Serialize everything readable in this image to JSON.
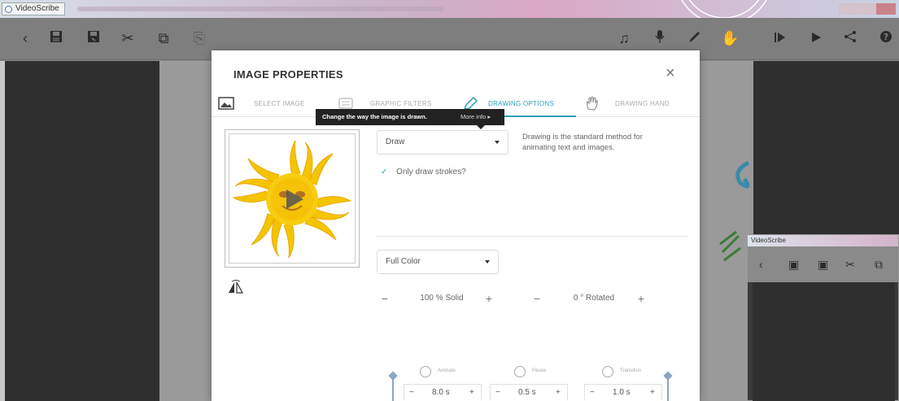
{
  "window": {
    "app_tab_label": "VideoScribe"
  },
  "toolbar": {
    "left_icons": [
      "back-icon",
      "save-icon",
      "save-as-icon",
      "cut-icon",
      "copy-icon",
      "paste-icon"
    ],
    "right_icons": [
      "music-icon",
      "microphone-icon",
      "pen-icon",
      "hand-icon",
      "play-from-icon",
      "play-icon",
      "share-icon",
      "help-icon"
    ]
  },
  "modal": {
    "title": "IMAGE PROPERTIES",
    "close_symbol": "×",
    "tabs": [
      {
        "label": "SELECT IMAGE",
        "icon": "image-icon",
        "active": false
      },
      {
        "label": "GRAPHIC FILTERS",
        "icon": "filters-icon",
        "active": false
      },
      {
        "label": "DRAWING OPTIONS",
        "icon": "pencil-icon",
        "active": true
      },
      {
        "label": "DRAWING HAND",
        "icon": "hand-icon",
        "active": false
      }
    ],
    "tooltip": {
      "text": "Change the way the image is drawn.",
      "more": "More info ▸"
    },
    "draw_mode": {
      "selected": "Draw",
      "description": "Drawing is the standard method for animating text and images."
    },
    "only_strokes": {
      "checked": true,
      "label": "Only draw strokes?"
    },
    "color_mode": {
      "selected": "Full Color"
    },
    "opacity": {
      "minus": "−",
      "value": "100 % Solid",
      "plus": "+"
    },
    "rotation": {
      "minus": "−",
      "value": "0 ° Rotated",
      "plus": "+"
    },
    "timings": [
      {
        "label": "Animate",
        "value": "8.0 s",
        "minus": "−",
        "plus": "+"
      },
      {
        "label": "Pause",
        "value": "0.5 s",
        "minus": "−",
        "plus": "+"
      },
      {
        "label": "Transition",
        "value": "1.0 s",
        "minus": "−",
        "plus": "+"
      }
    ]
  },
  "mini_window": {
    "title": "VideoScribe"
  },
  "colors": {
    "accent": "#2a9fb8",
    "toolbar_bg": "#7e7e7e",
    "dark_panel": "#2f2f2f",
    "sun_yellow": "#f5c400",
    "play_overlay": "#555555"
  }
}
